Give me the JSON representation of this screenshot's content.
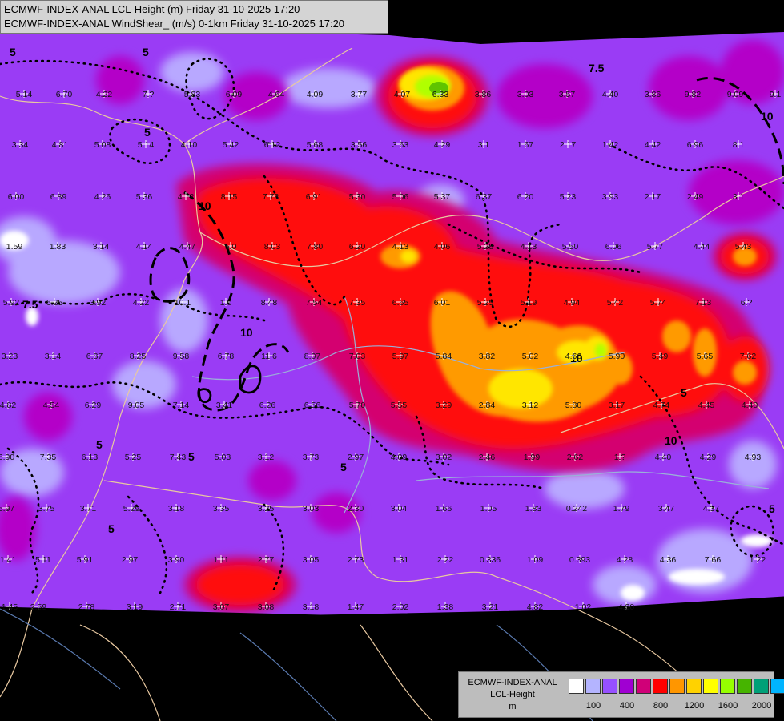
{
  "header": {
    "line1": "ECMWF-INDEX-ANAL LCL-Height (m) Friday 31-10-2025 17:20",
    "line2": "ECMWF-INDEX-ANAL WindShear_ (m/s) 0-1km Friday 31-10-2025 17:20"
  },
  "legend": {
    "title_lines": [
      "ECMWF-INDEX-ANAL",
      "LCL-Height",
      "m"
    ],
    "colors": [
      "#ffffff",
      "#b4b4ff",
      "#9650ff",
      "#a000d2",
      "#d00078",
      "#ff0000",
      "#ff9600",
      "#ffd200",
      "#ffff00",
      "#96ff00",
      "#46b400",
      "#00a078",
      "#00b4ff"
    ],
    "tick_labels": [
      "100",
      "400",
      "800",
      "1200",
      "1600",
      "2000"
    ],
    "tick_positions_swatch_index": [
      1,
      3,
      5,
      7,
      9,
      11
    ]
  },
  "colors": {
    "background": "#000000",
    "base_field": "#9a3cf5",
    "contour": "#000000",
    "border_lines": "#e8c8a0"
  },
  "station_values": [
    "5.14",
    "6.70",
    "4.22",
    "7.?",
    "5.83",
    "6.09",
    "4.64",
    "4.09",
    "3.77",
    "4.07",
    "6.33",
    "3.86",
    "3.03",
    "3.57",
    "4.40",
    "3.86",
    "9.82",
    "9.09",
    "9.1",
    "3.34",
    "4.81",
    "5.08",
    "5.14",
    "4.10",
    "5.42",
    "6.12",
    "5.68",
    "3.56",
    "3.63",
    "4.29",
    "3.1",
    "1.67",
    "2.17",
    "1.42",
    "4.42",
    "6.96",
    "8.1",
    "6.00",
    "6.89",
    "4.26",
    "5.36",
    "4.12",
    "8.15",
    "7.73",
    "6.91",
    "5.30",
    "5.06",
    "5.37",
    "6.37",
    "6.20",
    "5.23",
    "3.93",
    "2.17",
    "2.49",
    "3.1",
    "1.59",
    "1.83",
    "3.14",
    "4.14",
    "4.47",
    "5.0",
    "8.03",
    "7.80",
    "6.20",
    "4.13",
    "4.06",
    "5.28",
    "4.13",
    "5.50",
    "6.06",
    "5.77",
    "4.44",
    "5.43",
    "5.92",
    "6.25",
    "3.92",
    "4.22",
    "10.1",
    "1.0",
    "8.48",
    "7.54",
    "7.35",
    "6.65",
    "6.01",
    "5.25",
    "5.19",
    "4.94",
    "5.42",
    "5.74",
    "7.13",
    "6.?",
    "3.23",
    "3.14",
    "6.87",
    "8.25",
    "9.58",
    "6.78",
    "11.6",
    "8.07",
    "7.03",
    "5.97",
    "5.84",
    "3.82",
    "5.02",
    "4.66",
    "5.90",
    "5.49",
    "5.65",
    "7.62",
    "4.82",
    "4.54",
    "6.29",
    "9.05",
    "7.14",
    "3.41",
    "6.26",
    "6.56",
    "5.70",
    "5.55",
    "3.29",
    "2.84",
    "3.12",
    "5.80",
    "3.17",
    "4.74",
    "4.45",
    "4.40",
    "6.90",
    "7.35",
    "6.13",
    "5.25",
    "7.43",
    "5.03",
    "3.12",
    "3.73",
    "2.97",
    "4.09",
    "3.02",
    "2.46",
    "1.99",
    "2.62",
    "1.?",
    "4.40",
    "4.29",
    "4.93",
    "5.97",
    "3.75",
    "3.71",
    "5.29",
    "3.18",
    "3.35",
    "3.25",
    "3.03",
    "2.30",
    "3.04",
    "1.66",
    "1.05",
    "1.83",
    "0.242",
    "1.79",
    "3.47",
    "4.37",
    "1.41",
    "5.11",
    "5.91",
    "2.97",
    "3.90",
    "1.11",
    "2.77",
    "3.05",
    "2.73",
    "1.31",
    "2.22",
    "0.336",
    "1.09",
    "0.393",
    "4.28",
    "4.36",
    "7.66",
    "1.22",
    "1.45",
    "2.59",
    "2.78",
    "3.19",
    "2.71",
    "3.07",
    "3.08",
    "3.18",
    "1.47",
    "2.02",
    "1.38",
    "3.21",
    "4.82",
    "1.02",
    "4.30"
  ],
  "contour_labels": [
    "5",
    "5",
    "7.5",
    "7.5",
    "10",
    "10",
    "10",
    "10",
    "5",
    "5",
    "5",
    "5",
    "5",
    "5",
    "5",
    "10"
  ]
}
